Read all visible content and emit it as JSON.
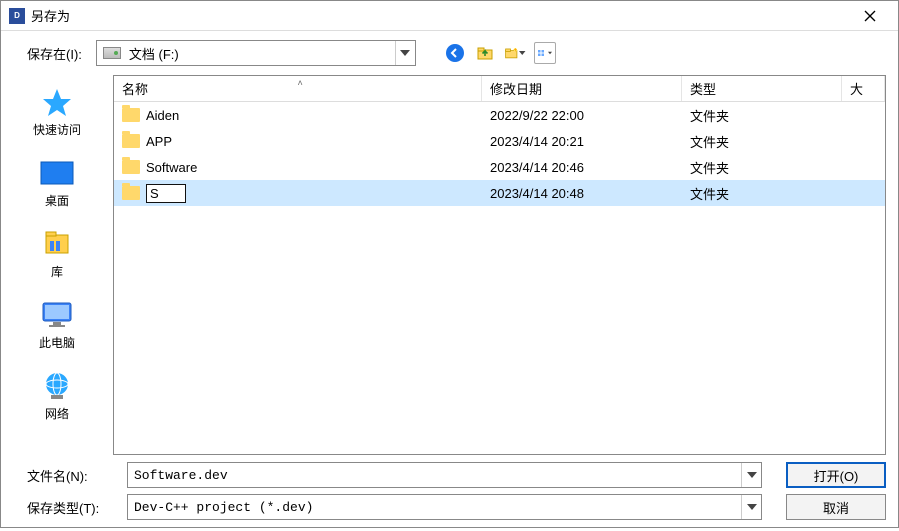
{
  "window": {
    "title": "另存为"
  },
  "lookin": {
    "label": "保存在(I):",
    "value": "文档 (F:)"
  },
  "toolbar": {
    "back": "back-icon",
    "up": "up-one-level-icon",
    "newfolder": "new-folder-icon",
    "viewmenu": "view-menu-icon"
  },
  "places": [
    {
      "key": "quick",
      "label": "快速访问"
    },
    {
      "key": "desktop",
      "label": "桌面"
    },
    {
      "key": "libs",
      "label": "库"
    },
    {
      "key": "thispc",
      "label": "此电脑"
    },
    {
      "key": "network",
      "label": "网络"
    }
  ],
  "columns": {
    "name": "名称",
    "date": "修改日期",
    "type": "类型",
    "size": "大"
  },
  "rows": [
    {
      "name": "Aiden",
      "date": "2022/9/22 22:00",
      "type": "文件夹",
      "editing": false,
      "selected": false
    },
    {
      "name": "APP",
      "date": "2023/4/14 20:21",
      "type": "文件夹",
      "editing": false,
      "selected": false
    },
    {
      "name": "Software",
      "date": "2023/4/14 20:46",
      "type": "文件夹",
      "editing": false,
      "selected": false
    },
    {
      "name": "S",
      "date": "2023/4/14 20:48",
      "type": "文件夹",
      "editing": true,
      "selected": true
    }
  ],
  "filename": {
    "label": "文件名(N):",
    "value": "Software.dev"
  },
  "filetype": {
    "label": "保存类型(T):",
    "value": "Dev-C++ project (*.dev)"
  },
  "buttons": {
    "open": "打开(O)",
    "cancel": "取消"
  }
}
